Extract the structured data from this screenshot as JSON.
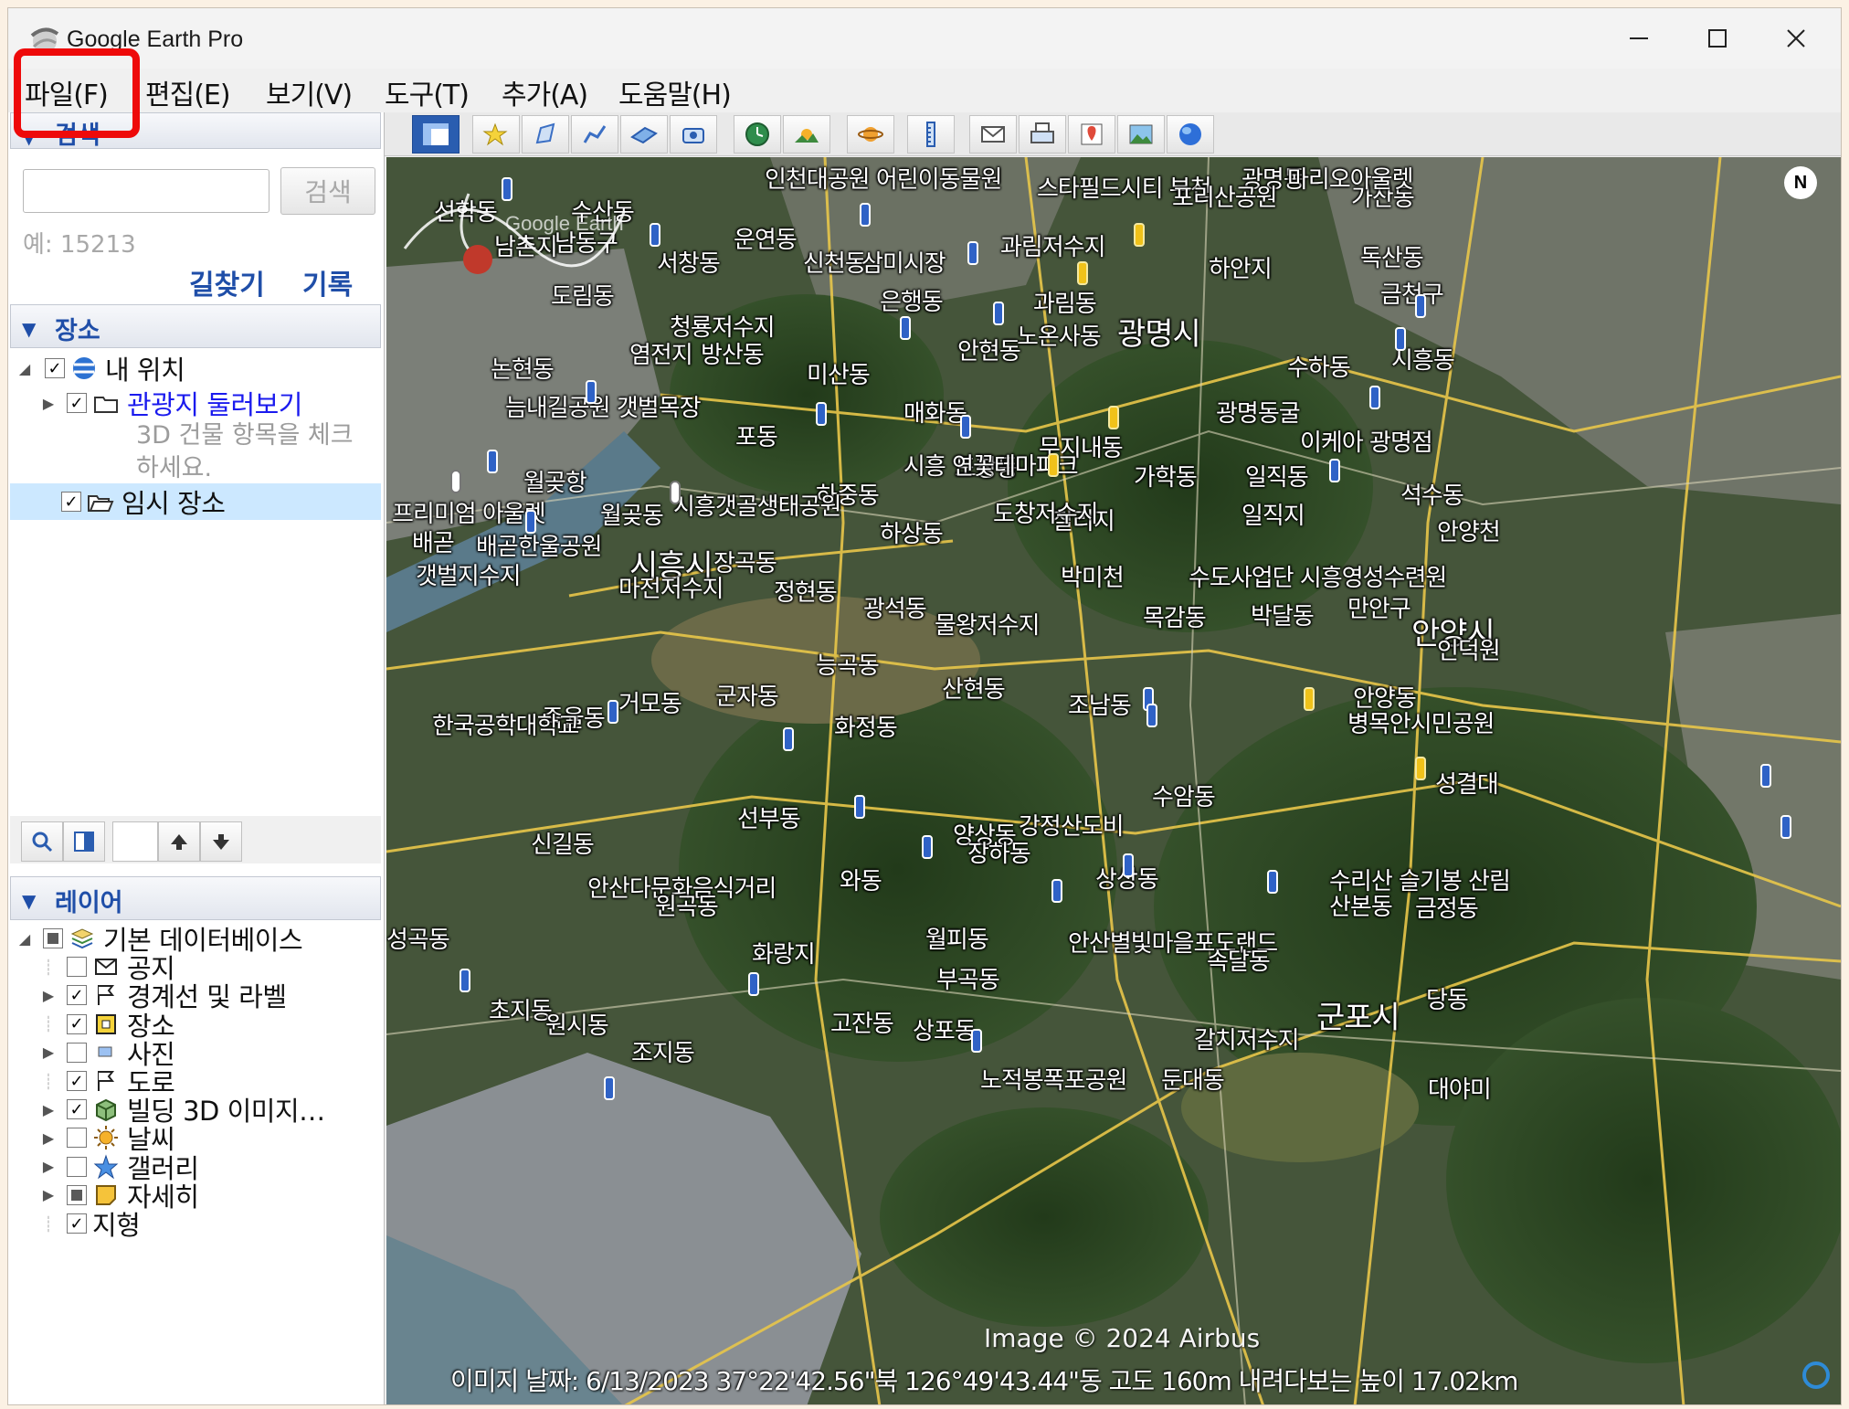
{
  "window": {
    "title": "Google Earth Pro"
  },
  "menu": {
    "items": [
      "파일(F)",
      "편집(E)",
      "보기(V)",
      "도구(T)",
      "추가(A)",
      "도움말(H)"
    ]
  },
  "search": {
    "header": "검색",
    "input_value": "",
    "button_label": "검색",
    "example": "예: 15213",
    "directions_link": "길찾기",
    "history_link": "기록"
  },
  "places": {
    "header": "장소",
    "my_places": "내 위치",
    "sightseeing": "관광지 둘러보기",
    "sightseeing_note": "3D 건물 항목을 체크하세요.",
    "temp_places": "임시 장소"
  },
  "layers": {
    "header": "레이어",
    "items": [
      {
        "label": "기본 데이터베이스",
        "state": "partial",
        "icon": "database-stack-icon"
      },
      {
        "label": "공지",
        "state": "unchecked",
        "icon": "envelope-icon"
      },
      {
        "label": "경계선 및 라벨",
        "state": "checked",
        "icon": "flag-icon"
      },
      {
        "label": "장소",
        "state": "checked",
        "icon": "place-square-icon"
      },
      {
        "label": "사진",
        "state": "unchecked",
        "icon": "photo-icon"
      },
      {
        "label": "도로",
        "state": "checked",
        "icon": "road-flag-icon"
      },
      {
        "label": "빌딩 3D 이미지…",
        "state": "checked",
        "icon": "building-3d-icon"
      },
      {
        "label": "날씨",
        "state": "unchecked",
        "icon": "sun-icon"
      },
      {
        "label": "갤러리",
        "state": "unchecked",
        "icon": "star-icon"
      },
      {
        "label": "자세히",
        "state": "partial",
        "icon": "note-icon"
      },
      {
        "label": "지형",
        "state": "checked",
        "icon": "terrain-icon"
      }
    ]
  },
  "map": {
    "labels": [
      {
        "t": "선학동"
      },
      {
        "t": "수산동"
      },
      {
        "t": "남촌지"
      },
      {
        "t": "남동구"
      },
      {
        "t": "운연동"
      },
      {
        "t": "서창동"
      },
      {
        "t": "신천동"
      },
      {
        "t": "삼미시장"
      },
      {
        "t": "과림저수지"
      },
      {
        "t": "하안지"
      },
      {
        "t": "독산동"
      },
      {
        "t": "금천구"
      },
      {
        "t": "도림동"
      },
      {
        "t": "은행동"
      },
      {
        "t": "과림동"
      },
      {
        "t": "청룡저수지"
      },
      {
        "t": "광명시"
      },
      {
        "t": "노온사동"
      },
      {
        "t": "논현동"
      },
      {
        "t": "염전지"
      },
      {
        "t": "방산동"
      },
      {
        "t": "안현동"
      },
      {
        "t": "미산동"
      },
      {
        "t": "시흥동"
      },
      {
        "t": "수하동"
      },
      {
        "t": "늠내길공원 갯벌목장"
      },
      {
        "t": "매화동"
      },
      {
        "t": "광명동굴"
      },
      {
        "t": "포동"
      },
      {
        "t": "무지내동"
      },
      {
        "t": "도창동"
      },
      {
        "t": "이케아 광명점"
      },
      {
        "t": "가학동"
      },
      {
        "t": "일직동"
      },
      {
        "t": "월곶항"
      },
      {
        "t": "시흥 연꽃테마파크"
      },
      {
        "t": "석수동"
      },
      {
        "t": "하중동"
      },
      {
        "t": "시흥갯골생태공원"
      },
      {
        "t": "월곶동"
      },
      {
        "t": "프리미엄 아울렛"
      },
      {
        "t": "일직지"
      },
      {
        "t": "칠리지"
      },
      {
        "t": "도창저수지"
      },
      {
        "t": "하상동"
      },
      {
        "t": "안양천"
      },
      {
        "t": "배곧"
      },
      {
        "t": "배곧한울공원"
      },
      {
        "t": "갯벌지수지"
      },
      {
        "t": "시흥시"
      },
      {
        "t": "장곡동"
      },
      {
        "t": "박미천"
      },
      {
        "t": "수도사업단 시흥영성수련원"
      },
      {
        "t": "마전저수지"
      },
      {
        "t": "정현동"
      },
      {
        "t": "광석동"
      },
      {
        "t": "물왕저수지"
      },
      {
        "t": "목감동"
      },
      {
        "t": "박달동"
      },
      {
        "t": "만안구"
      },
      {
        "t": "안양시"
      },
      {
        "t": "인덕원"
      },
      {
        "t": "능곡동"
      },
      {
        "t": "산현동"
      },
      {
        "t": "군자동"
      },
      {
        "t": "거모동"
      },
      {
        "t": "조남동"
      },
      {
        "t": "안양동"
      },
      {
        "t": "병목안시민공원"
      },
      {
        "t": "죽율동"
      },
      {
        "t": "화정동"
      },
      {
        "t": "한국공학대학교"
      },
      {
        "t": "수암동"
      },
      {
        "t": "성결대"
      },
      {
        "t": "선부동"
      },
      {
        "t": "강정산도비"
      },
      {
        "t": "양상동"
      },
      {
        "t": "장하동"
      },
      {
        "t": "신길동"
      },
      {
        "t": "상상동"
      },
      {
        "t": "와동"
      },
      {
        "t": "수리산 슬기봉 산림"
      },
      {
        "t": "산본동"
      },
      {
        "t": "금정동"
      },
      {
        "t": "안산다문화음식거리"
      },
      {
        "t": "원곡동"
      },
      {
        "t": "월피동"
      },
      {
        "t": "안산별빛마을포도랜드"
      },
      {
        "t": "속달동"
      },
      {
        "t": "성곡동"
      },
      {
        "t": "화랑지"
      },
      {
        "t": "부곡동"
      },
      {
        "t": "군포시"
      },
      {
        "t": "당동"
      },
      {
        "t": "초지동"
      },
      {
        "t": "원시동"
      },
      {
        "t": "고잔동"
      },
      {
        "t": "상포동"
      },
      {
        "t": "갈치저수지"
      },
      {
        "t": "둔대동"
      },
      {
        "t": "노적봉폭포공원"
      },
      {
        "t": "조지동"
      },
      {
        "t": "대야미"
      },
      {
        "t": "인천대공원 어린이동물원"
      },
      {
        "t": "스타필드시티 부천"
      },
      {
        "t": "광명동"
      },
      {
        "t": "포리산공원"
      },
      {
        "t": "가산동"
      },
      {
        "t": "마리오아울렛"
      }
    ],
    "copyright": "Image © 2024 Airbus",
    "compass_letter": "N",
    "watermark": "Google Earth"
  },
  "status": {
    "text": "이미지 날짜: 6/13/2023    37°22'42.56\"북  126°49'43.44\"동  고도  160m    내려다보는 높이  17.02km"
  }
}
